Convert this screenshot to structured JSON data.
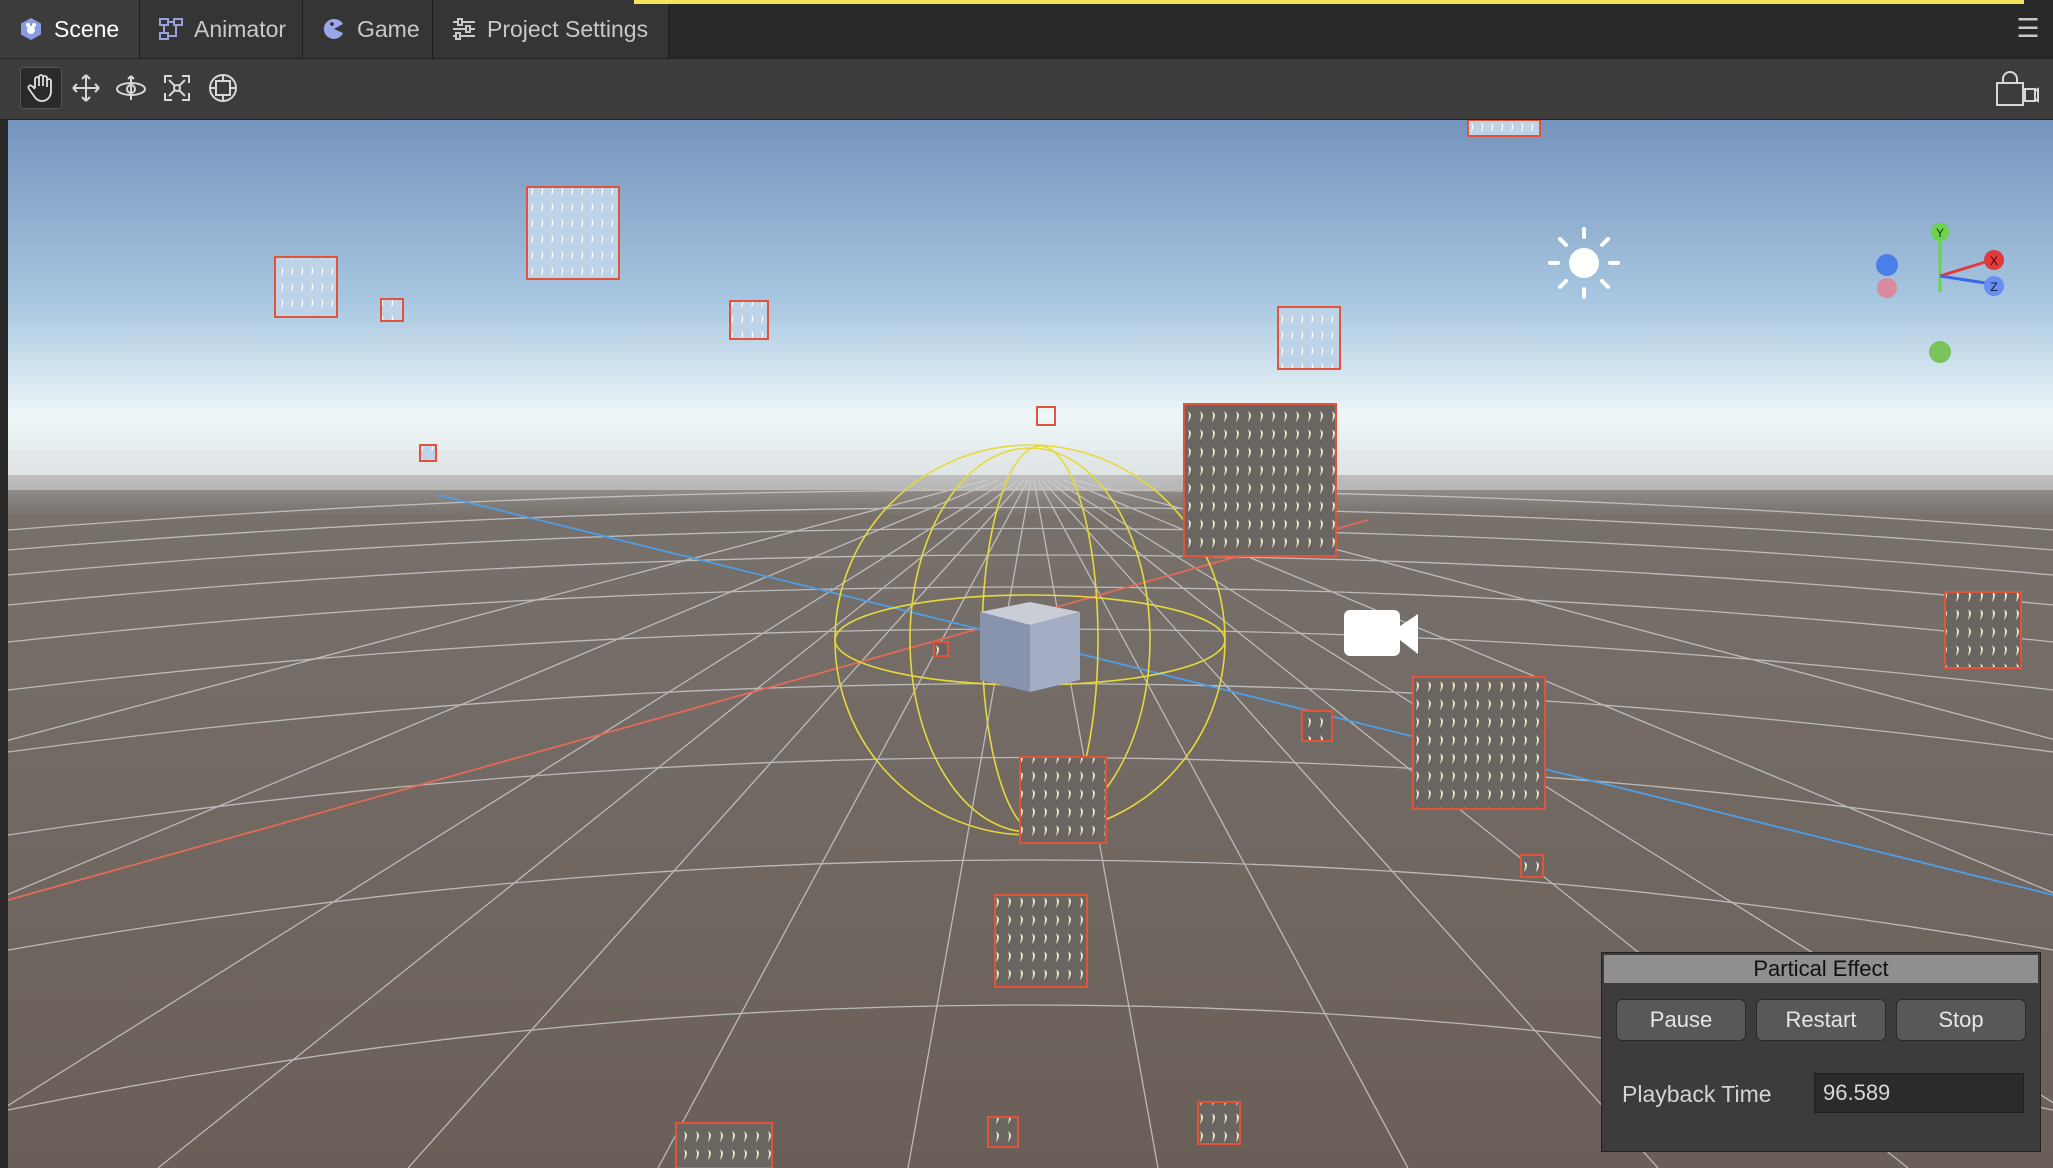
{
  "tabs": [
    {
      "id": "scene",
      "label": "Scene",
      "active": true
    },
    {
      "id": "animator",
      "label": "Animator",
      "active": false
    },
    {
      "id": "game",
      "label": "Game",
      "active": false
    },
    {
      "id": "project-settings",
      "label": "Project Settings",
      "active": false
    }
  ],
  "menu_icon": "hamburger-menu-icon",
  "toolbar": {
    "tools": [
      "hand-tool-icon",
      "move-tool-icon",
      "rotate-tool-icon",
      "scale-tool-icon",
      "rect-tool-icon"
    ],
    "active_tool": "hand-tool-icon",
    "scene_options_icon": "scene-view-options-icon"
  },
  "gizmo": {
    "axis_y": "Y",
    "axis_x": "X",
    "axis_z": "Z"
  },
  "colors": {
    "accent": "#f2e45c",
    "particle_border": "#e2543a",
    "sky_top": "#7c98be",
    "ground": "#6b615b"
  },
  "particle_panel": {
    "title": "Partical Effect",
    "pause_label": "Pause",
    "restart_label": "Restart",
    "stop_label": "Stop",
    "playback_time_label": "Playback Time",
    "playback_time_value": "96.589"
  }
}
